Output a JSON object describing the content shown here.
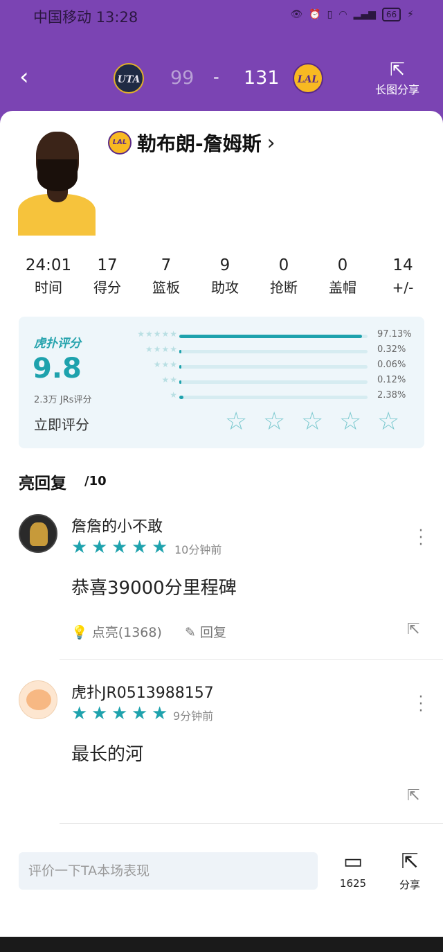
{
  "status_bar": {
    "carrier_time": "中国移动 13:28",
    "battery": "66",
    "icons": [
      "eye-icon",
      "alarm-icon",
      "vibrate-icon",
      "wifi-icon",
      "signal-5g-icon",
      "charging-icon"
    ]
  },
  "game": {
    "away_team_logo": "UTA",
    "away_score": "99",
    "separator": "-",
    "home_score": "131",
    "home_team_logo": "LAL",
    "share_label": "长图分享"
  },
  "player": {
    "name": "勒布朗-詹姆斯",
    "team_logo": "LAL"
  },
  "stats": [
    {
      "value": "24:01",
      "label": "时间"
    },
    {
      "value": "17",
      "label": "得分"
    },
    {
      "value": "7",
      "label": "篮板"
    },
    {
      "value": "9",
      "label": "助攻"
    },
    {
      "value": "0",
      "label": "抢断"
    },
    {
      "value": "0",
      "label": "盖帽"
    },
    {
      "value": "14",
      "label": "+/-"
    }
  ],
  "rating": {
    "brand": "虎扑评分",
    "score": "9.8",
    "count_label": "2.3万 JRs评分",
    "rate_now": "立即评分",
    "distribution": [
      {
        "stars": "★★★★★",
        "percent": "97.13%",
        "fraction": 0.9713
      },
      {
        "stars": "★★★★",
        "percent": "0.32%",
        "fraction": 0.0032
      },
      {
        "stars": "★★★",
        "percent": "0.06%",
        "fraction": 0.0006
      },
      {
        "stars": "★★",
        "percent": "0.12%",
        "fraction": 0.0012
      },
      {
        "stars": "★",
        "percent": "2.38%",
        "fraction": 0.0238
      }
    ],
    "user_rating_stars": 5
  },
  "highlight": {
    "title": "亮回复",
    "count": "/10"
  },
  "comments": [
    {
      "user": "詹詹的小不敢",
      "stars": 5,
      "time": "10分钟前",
      "text": "恭喜39000分里程碑",
      "light_label": "点亮(1368)",
      "reply_label": "回复"
    },
    {
      "user": "虎扑JR0513988157",
      "stars": 5,
      "time": "9分钟前",
      "text": "最长的河"
    }
  ],
  "bottom": {
    "placeholder": "评价一下TA本场表现",
    "comment_count": "1625",
    "share_label": "分享"
  },
  "colors": {
    "header": "#7b44b3",
    "accent": "#1ea2ad",
    "rating_bg": "#eef6fa"
  }
}
